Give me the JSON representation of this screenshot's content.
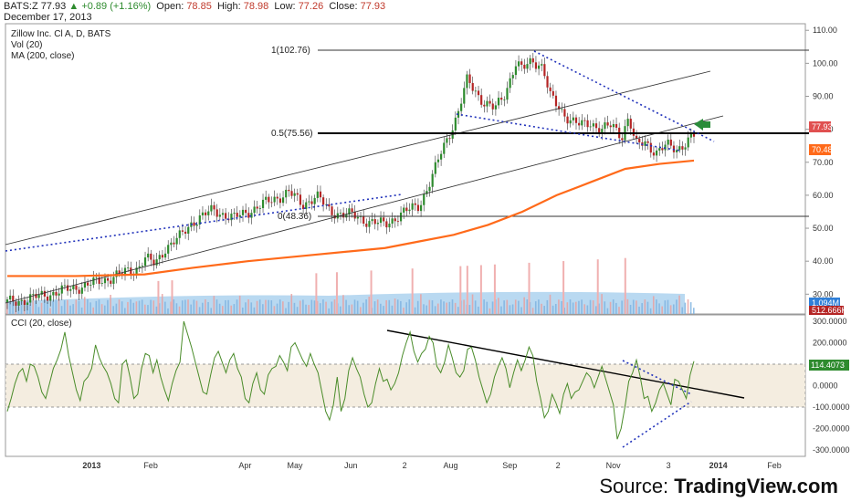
{
  "header": {
    "symbol": "BATS:Z",
    "last": "77.93",
    "change": "+0.89 (+1.16%)",
    "open_label": "Open:",
    "open": "78.85",
    "high_label": "High:",
    "high": "78.98",
    "low_label": "Low:",
    "low": "77.26",
    "close_label": "Close:",
    "close": "77.93",
    "date": "December 17, 2013"
  },
  "indicators": {
    "title": "Zillow Inc. Cl A, D, BATS",
    "vol": "Vol (20)",
    "ma": "MA (200, close)",
    "cci": "CCI (20, close)"
  },
  "source": {
    "prefix": "Source: ",
    "name": "TradingView.com"
  },
  "chart_data": [
    {
      "type": "candlestick",
      "title": "Zillow Inc. Cl A, D, BATS",
      "ylim": [
        24,
        112
      ],
      "y_ticks": [
        "110.00",
        "100.00",
        "90.00",
        "80.00",
        "70.00",
        "60.00",
        "50.00",
        "40.00",
        "30.00"
      ],
      "x_ticks": [
        "2013",
        "Feb",
        "Apr",
        "May",
        "Jun",
        "2",
        "Aug",
        "Sep",
        "2",
        "Nov",
        "3",
        "2014",
        "Feb"
      ],
      "fib_levels": [
        {
          "label": "1(102.76)",
          "value": 102.76
        },
        {
          "label": "0.5(75.56)",
          "value": 75.56
        },
        {
          "label": "0(48.36)",
          "value": 48.36
        }
      ],
      "price_tags": [
        {
          "label": "77.93",
          "value": 77.93,
          "color": "#e05050"
        },
        {
          "label": "70.48",
          "value": 70.48,
          "color": "#ff6a1a"
        }
      ],
      "volume_tags": [
        "1.094M",
        "512.666K"
      ],
      "close_points": [
        [
          0,
          27.5
        ],
        [
          0.03,
          28.5
        ],
        [
          0.06,
          30
        ],
        [
          0.09,
          31.5
        ],
        [
          0.12,
          33
        ],
        [
          0.15,
          35
        ],
        [
          0.17,
          36.5
        ],
        [
          0.19,
          38
        ],
        [
          0.2,
          41
        ],
        [
          0.215,
          39
        ],
        [
          0.23,
          44
        ],
        [
          0.25,
          47
        ],
        [
          0.27,
          52
        ],
        [
          0.3,
          55.5
        ],
        [
          0.33,
          53
        ],
        [
          0.36,
          56
        ],
        [
          0.38,
          58
        ],
        [
          0.41,
          61
        ],
        [
          0.43,
          57
        ],
        [
          0.45,
          60
        ],
        [
          0.47,
          55
        ],
        [
          0.5,
          54
        ],
        [
          0.52,
          52.5
        ],
        [
          0.55,
          51
        ],
        [
          0.57,
          54
        ],
        [
          0.6,
          57
        ],
        [
          0.62,
          66
        ],
        [
          0.63,
          72
        ],
        [
          0.64,
          77
        ],
        [
          0.655,
          84
        ],
        [
          0.67,
          95
        ],
        [
          0.68,
          92
        ],
        [
          0.695,
          88
        ],
        [
          0.71,
          86
        ],
        [
          0.725,
          91
        ],
        [
          0.74,
          100
        ],
        [
          0.75,
          98
        ],
        [
          0.765,
          101
        ],
        [
          0.78,
          99
        ],
        [
          0.79,
          90
        ],
        [
          0.805,
          86
        ],
        [
          0.82,
          83
        ],
        [
          0.835,
          81
        ],
        [
          0.85,
          82
        ],
        [
          0.865,
          80
        ],
        [
          0.88,
          81
        ],
        [
          0.895,
          78
        ],
        [
          0.905,
          84
        ],
        [
          0.915,
          75
        ],
        [
          0.93,
          76
        ],
        [
          0.945,
          73
        ],
        [
          0.96,
          75
        ],
        [
          0.975,
          74
        ],
        [
          1,
          77.9
        ]
      ],
      "ma_200_points": [
        [
          0,
          35.5
        ],
        [
          0.1,
          35.5
        ],
        [
          0.2,
          36
        ],
        [
          0.27,
          38
        ],
        [
          0.35,
          40
        ],
        [
          0.45,
          42
        ],
        [
          0.55,
          44
        ],
        [
          0.6,
          46
        ],
        [
          0.65,
          48
        ],
        [
          0.7,
          51
        ],
        [
          0.75,
          55
        ],
        [
          0.8,
          60
        ],
        [
          0.85,
          64
        ],
        [
          0.9,
          68
        ],
        [
          0.95,
          69.5
        ],
        [
          1,
          70.5
        ]
      ],
      "volume_spikes": [
        0.22,
        0.24,
        0.45,
        0.48,
        0.53,
        0.59,
        0.66,
        0.67,
        0.69,
        0.71,
        0.76,
        0.81,
        0.86,
        0.9
      ]
    },
    {
      "type": "line",
      "title": "CCI (20, close)",
      "ylim": [
        -330,
        330
      ],
      "y_ticks": [
        "300.0000",
        "200.0000",
        "100.0000",
        "0.0000",
        "-100.0000",
        "-200.0000",
        "-300.0000"
      ],
      "band": [
        -100,
        100
      ],
      "last_value": "114.4073",
      "series": [
        {
          "values": [
            -120,
            -60,
            10,
            60,
            80,
            20,
            100,
            90,
            40,
            -30,
            -60,
            10,
            80,
            120,
            170,
            250,
            140,
            60,
            -20,
            -70,
            20,
            40,
            80,
            190,
            130,
            90,
            60,
            10,
            -60,
            -80,
            100,
            120,
            40,
            -60,
            -40,
            80,
            150,
            140,
            60,
            120,
            40,
            -20,
            -70,
            10,
            70,
            110,
            300,
            240,
            180,
            110,
            40,
            -30,
            -40,
            50,
            130,
            160,
            110,
            60,
            120,
            150,
            80,
            40,
            -60,
            -80,
            10,
            60,
            -20,
            -40,
            50,
            80,
            90,
            140,
            110,
            70,
            180,
            200,
            160,
            120,
            90,
            150,
            100,
            60,
            -30,
            -120,
            -160,
            -90,
            40,
            -120,
            -60,
            70,
            130,
            80,
            40,
            -40,
            -100,
            -80,
            10,
            80,
            20,
            30,
            -20,
            10,
            60,
            140,
            200,
            250,
            160,
            110,
            150,
            170,
            230,
            200,
            90,
            60,
            110,
            190,
            130,
            60,
            40,
            70,
            170,
            180,
            120,
            40,
            -20,
            -80,
            -40,
            40,
            90,
            130,
            80,
            -10,
            60,
            120,
            70,
            120,
            180,
            140,
            20,
            -60,
            -150,
            -120,
            -40,
            -80,
            -130,
            -40,
            10,
            -60,
            -30,
            -20,
            20,
            60,
            40,
            -10,
            40,
            90,
            30,
            -30,
            -90,
            -250,
            -200,
            -100,
            20,
            60,
            120,
            40,
            -60,
            -50,
            -120,
            -80,
            -20,
            10,
            -40,
            -90,
            30,
            20,
            -20,
            -60,
            50,
            114
          ]
        }
      ]
    }
  ]
}
